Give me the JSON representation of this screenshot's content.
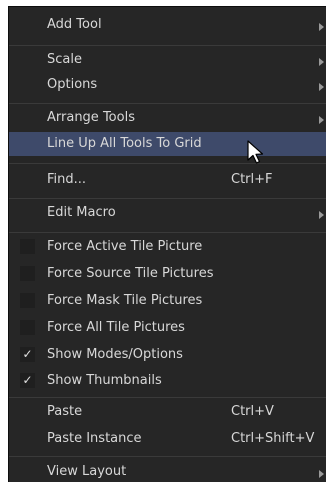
{
  "menu": {
    "items": [
      {
        "label": "Add Tool",
        "submenu": true
      },
      {
        "label": "Scale",
        "submenu": true
      },
      {
        "label": "Options",
        "submenu": true
      },
      {
        "label": "Arrange Tools",
        "submenu": true
      },
      {
        "label": "Line Up All Tools To Grid",
        "highlighted": true
      },
      {
        "label": "Find...",
        "shortcut": "Ctrl+F"
      },
      {
        "label": "Edit Macro",
        "submenu": true
      },
      {
        "label": "Force Active Tile Picture",
        "checked": false
      },
      {
        "label": "Force Source Tile Pictures",
        "checked": false
      },
      {
        "label": "Force Mask Tile Pictures",
        "checked": false
      },
      {
        "label": "Force All Tile Pictures",
        "checked": false
      },
      {
        "label": "Show Modes/Options",
        "checked": true,
        "check_glyph": "✓"
      },
      {
        "label": "Show Thumbnails",
        "checked": true,
        "check_glyph": "✓"
      },
      {
        "label": "Paste",
        "shortcut": "Ctrl+V"
      },
      {
        "label": "Paste Instance",
        "shortcut": "Ctrl+Shift+V"
      },
      {
        "label": "View Layout",
        "submenu": true
      }
    ]
  },
  "colors": {
    "menu_background": "#262626",
    "highlight": "#3e4a6a",
    "text": "#d8d8d8",
    "separator": "#3a3a3a"
  }
}
